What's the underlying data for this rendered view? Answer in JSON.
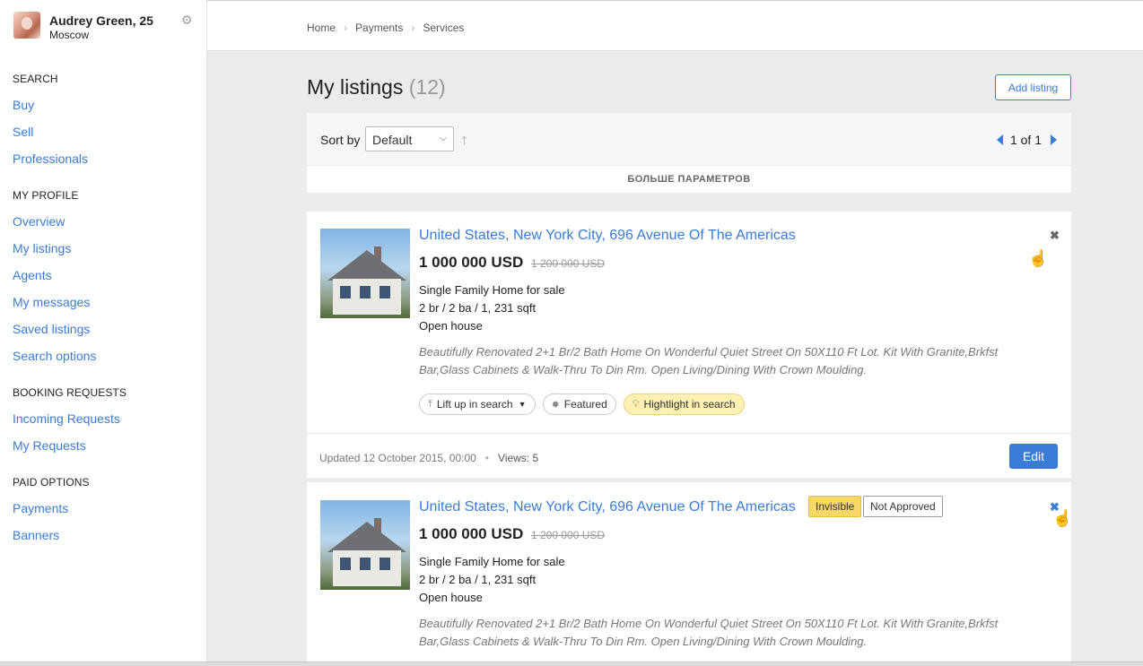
{
  "profile": {
    "name": "Audrey Green, 25",
    "city": "Moscow"
  },
  "sidebar": {
    "sections": [
      {
        "title": "SEARCH",
        "items": [
          "Buy",
          "Sell",
          "Professionals"
        ]
      },
      {
        "title": "MY PROFILE",
        "items": [
          "Overview",
          "My listings",
          "Agents",
          "My messages",
          "Saved listings",
          "Search options"
        ]
      },
      {
        "title": "BOOKING REQUESTS",
        "items": [
          "Incoming Requests",
          "My Requests"
        ]
      },
      {
        "title": "PAID OPTIONS",
        "items": [
          "Payments",
          "Banners"
        ]
      }
    ]
  },
  "breadcrumbs": [
    "Home",
    "Payments",
    "Services"
  ],
  "main": {
    "title": "My listings",
    "count": "(12)",
    "add_button": "Add listing",
    "sort_label": "Sort by",
    "sort_value": "Default",
    "pager": "1 of 1",
    "more_params": "БОЛЬШЕ ПАРАМЕТРОВ"
  },
  "listings": [
    {
      "address": "United States, New York City, 696 Avenue Of The Americas",
      "price": "1 000 000 USD",
      "old_price": "1 200 000 USD",
      "type": "Single Family Home for sale",
      "specs": "2 br / 2 ba / 1, 231 sqft",
      "open_house": "Open house",
      "description": "Beautifully Renovated 2+1 Br/2 Bath Home On Wonderful Quiet Street On 50X110 Ft Lot. Kit With Granite,Brkfst Bar,Glass Cabinets & Walk-Thru To Din Rm. Open Living/Dining With Crown Moulding.",
      "chips": [
        "Lift up in search",
        "Featured",
        "Hightlight in search"
      ],
      "updated": "Updated 12 October 2015, 00:00",
      "views": "Views: 5",
      "edit": "Edit"
    },
    {
      "address": "United States, New York City, 696 Avenue Of The Americas",
      "badges": [
        "Invisible",
        "Not Approved"
      ],
      "price": "1 000 000 USD",
      "old_price": "1 200 000 USD",
      "type": "Single Family Home for sale",
      "specs": "2 br / 2 ba / 1, 231 sqft",
      "open_house": "Open house",
      "description": "Beautifully Renovated 2+1 Br/2 Bath Home On Wonderful Quiet Street On 50X110 Ft Lot. Kit With Granite,Brkfst Bar,Glass Cabinets & Walk-Thru To Din Rm. Open Living/Dining With Crown Moulding."
    }
  ],
  "colors": {
    "link": "#3a7bd5",
    "badge_invisible": "#f7d766",
    "chip_highlight": "#fdf0b3"
  }
}
